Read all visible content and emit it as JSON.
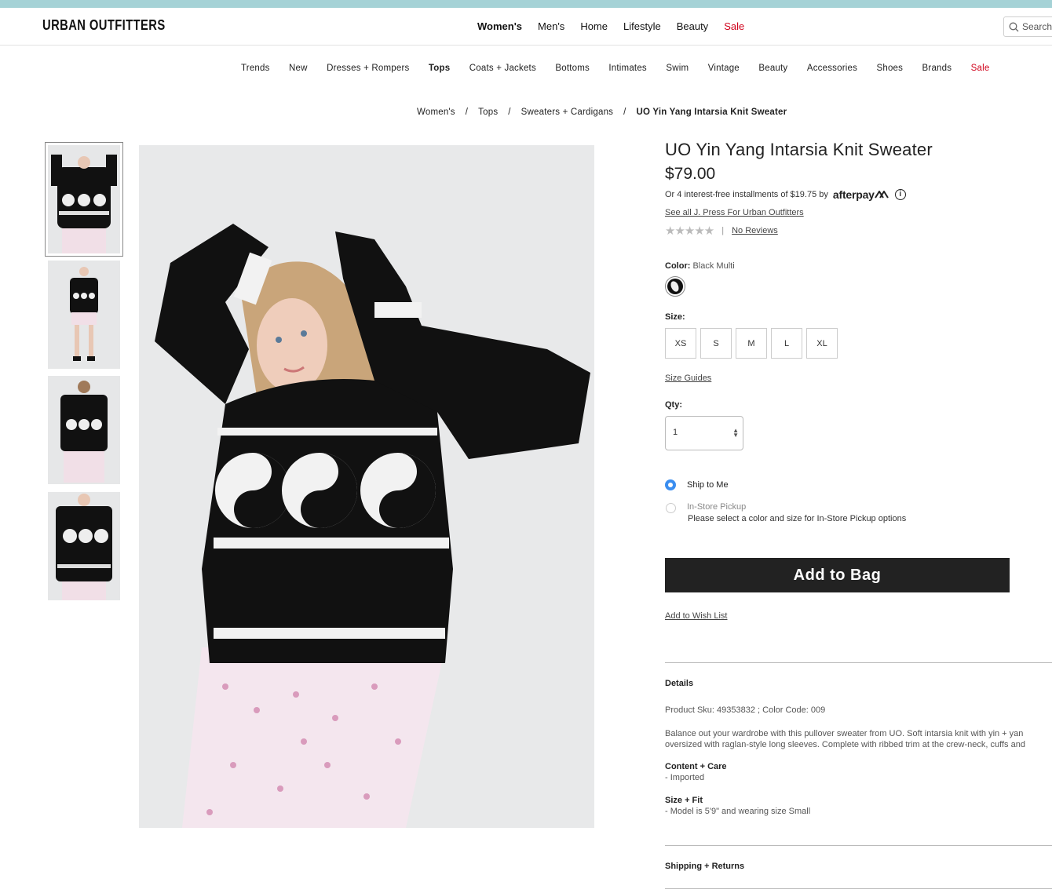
{
  "header": {
    "logo": "URBAN OUTFITTERS",
    "primary_nav": [
      "Women's",
      "Men's",
      "Home",
      "Lifestyle",
      "Beauty",
      "Sale"
    ],
    "search_placeholder": "Search"
  },
  "secondary_nav": [
    "Trends",
    "New",
    "Dresses + Rompers",
    "Tops",
    "Coats + Jackets",
    "Bottoms",
    "Intimates",
    "Swim",
    "Vintage",
    "Beauty",
    "Accessories",
    "Shoes",
    "Brands",
    "Sale"
  ],
  "breadcrumb": [
    "Women's",
    "Tops",
    "Sweaters + Cardigans",
    "UO Yin Yang Intarsia Knit Sweater"
  ],
  "breadcrumb_separator": "/",
  "product": {
    "title": "UO Yin Yang Intarsia Knit Sweater",
    "price": "$79.00",
    "afterpay_text": "Or 4 interest-free installments of $19.75 by",
    "afterpay_logo": "afterpay",
    "brand_link": "See all J. Press For Urban Outfitters",
    "rating": 0,
    "stars": "★★★★★",
    "reviews_link": "No Reviews",
    "color_label": "Color:",
    "color_value": "Black Multi",
    "size_label": "Size:",
    "sizes": [
      "XS",
      "S",
      "M",
      "L",
      "XL"
    ],
    "size_guides": "Size Guides",
    "qty_label": "Qty:",
    "qty_value": "1",
    "ship_to_me": "Ship to Me",
    "in_store_pickup": "In-Store Pickup",
    "pickup_note": "Please select a color and size for In-Store Pickup options",
    "add_to_bag": "Add to Bag",
    "wish_list": "Add to Wish List"
  },
  "details": {
    "title": "Details",
    "sku_line": "Product Sku: 49353832 ; Color Code: 009",
    "description_line1": "Balance out your wardrobe with this pullover sweater from UO. Soft intarsia knit with yin + yan",
    "description_line2": "oversized with raglan-style long sleeves. Complete with ribbed trim at the crew-neck, cuffs and",
    "content_care_title": "Content + Care",
    "content_care_text": "- Imported",
    "size_fit_title": "Size + Fit",
    "size_fit_text": "- Model is 5'9\" and wearing size Small",
    "shipping_title": "Shipping + Returns"
  },
  "colors": {
    "accent_top": "#a5d2d6",
    "sale": "#d0021b",
    "button": "#222222",
    "radio": "#3b8ef0"
  }
}
